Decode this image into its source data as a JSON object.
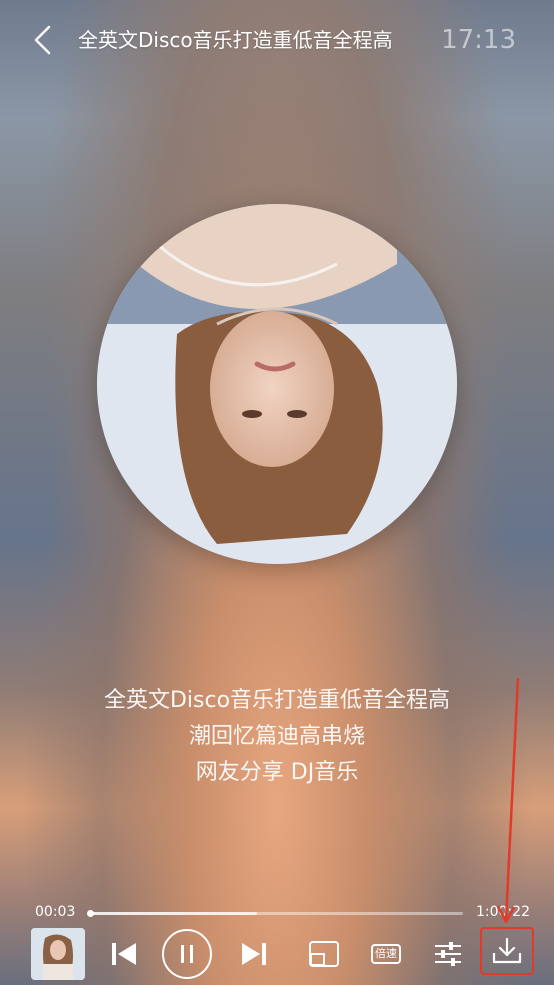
{
  "header": {
    "title": "全英文Disco音乐打造重低音全程高",
    "clock": "17:13"
  },
  "lyrics": {
    "line1": "全英文Disco音乐打造重低音全程高",
    "line2": "潮回忆篇迪高串烧",
    "line3": "网友分享  DJ音乐"
  },
  "player": {
    "current_time": "00:03",
    "total_time": "1:00:22",
    "progress": 0.004,
    "buffered": 0.45,
    "speed_label": "倍速"
  },
  "colors": {
    "annotation_red": "#e23a2a"
  },
  "icons": {
    "back": "back-chevron-icon",
    "prev": "skip-previous-icon",
    "play": "pause-icon",
    "next": "skip-next-icon",
    "pip": "picture-in-picture-icon",
    "eq": "equalizer-sliders-icon",
    "download": "download-icon"
  }
}
